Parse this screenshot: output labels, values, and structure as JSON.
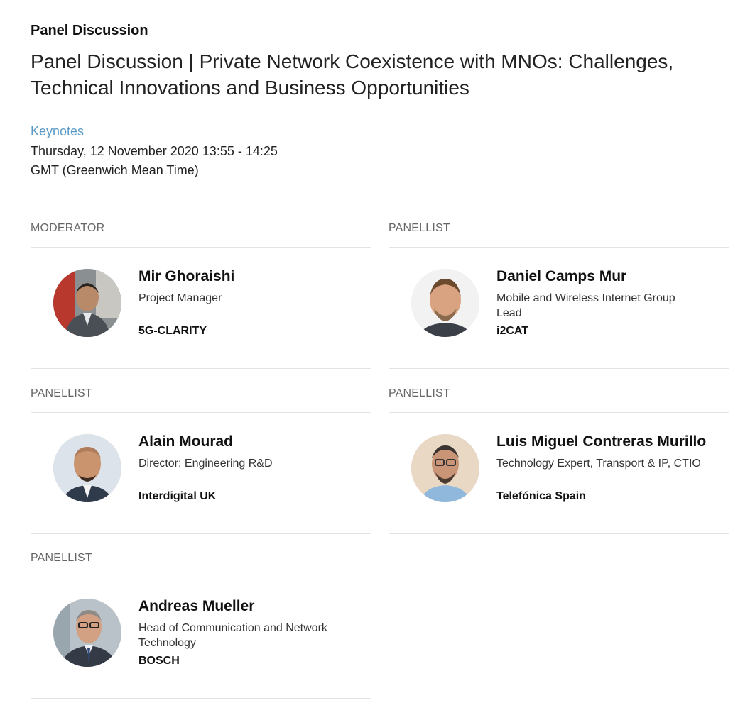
{
  "session": {
    "type": "Panel Discussion",
    "title": "Panel Discussion | Private Network Coexistence with MNOs: Challenges, Technical Innovations and Business Opportunities",
    "track": "Keynotes",
    "date_time": "Thursday, 12 November 2020 13:55 - 14:25",
    "timezone": "GMT (Greenwich Mean Time)"
  },
  "speakers": [
    {
      "role": "MODERATOR",
      "name": "Mir Ghoraishi",
      "job_title": "Project Manager",
      "organization": "5G-CLARITY"
    },
    {
      "role": "PANELLIST",
      "name": "Daniel Camps Mur",
      "job_title": "Mobile and Wireless Internet Group Lead",
      "organization": "i2CAT"
    },
    {
      "role": "PANELLIST",
      "name": "Alain Mourad",
      "job_title": "Director: Engineering R&D",
      "organization": "Interdigital UK"
    },
    {
      "role": "PANELLIST",
      "name": "Luis Miguel Contreras Murillo",
      "job_title": "Technology Expert, Transport & IP, CTIO",
      "organization": "Telefónica Spain"
    },
    {
      "role": "PANELLIST",
      "name": "Andreas Mueller",
      "job_title": "Head of Communication and Network Technology",
      "organization": "BOSCH"
    }
  ],
  "colors": {
    "track_link": "#5b9ac6",
    "card_border": "#e3e3e3",
    "role_label": "#666666"
  }
}
